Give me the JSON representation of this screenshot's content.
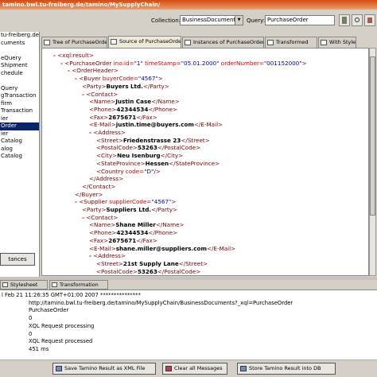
{
  "window": {
    "title": "tamino.bwl.tu-freiberg.de/tamino/MySupplyChain/"
  },
  "toolbar": {
    "collection_label": "Collection:",
    "collection_value": "BusinessDocuments",
    "query_label": "Query:",
    "query_value": "PurchaseOrder"
  },
  "sidebar": {
    "items": [
      "tu-freiberg.de/t",
      "cuments",
      "",
      "eQuery",
      "Shipment",
      "chedule",
      "",
      "Query",
      "gTransaction",
      "firm",
      "Transaction",
      "ier",
      "Order",
      "ier",
      "Catalog",
      "alog",
      "Catalog"
    ],
    "selected_index": 12,
    "instances_button": "tances"
  },
  "tabs": [
    {
      "label": "Tree of PurchaseOrder",
      "active": false
    },
    {
      "label": "Source of PurchaseOrder",
      "active": true
    },
    {
      "label": "Instances of PurchaseOrder",
      "active": false
    },
    {
      "label": "Transformed",
      "active": false
    },
    {
      "label": "With Style",
      "active": false
    }
  ],
  "xml": {
    "lines": [
      {
        "depth": 0,
        "open": "<xql:result>"
      },
      {
        "depth": 1,
        "po": true
      },
      {
        "depth": 2,
        "open": "<OrderHeader>"
      },
      {
        "depth": 3,
        "buyer": true
      },
      {
        "depth": 4,
        "elem": "Party",
        "text": "Buyers Ltd."
      },
      {
        "depth": 4,
        "open": "<Contact>"
      },
      {
        "depth": 5,
        "elem": "Name",
        "text": "Justin Case"
      },
      {
        "depth": 5,
        "elem": "Phone",
        "text": "42344534"
      },
      {
        "depth": 5,
        "elem": "Fax",
        "text": "2675671"
      },
      {
        "depth": 5,
        "elem": "E-Mail",
        "text": "justin.time@buyers.com"
      },
      {
        "depth": 5,
        "open": "<Address>"
      },
      {
        "depth": 6,
        "elem": "Street",
        "text": "Friedenstrasse 23"
      },
      {
        "depth": 6,
        "elem": "PostalCode",
        "text": "53263"
      },
      {
        "depth": 6,
        "elem": "City",
        "text": "Neu Isenburg"
      },
      {
        "depth": 6,
        "elem": "StateProvince",
        "text": "Hessen"
      },
      {
        "depth": 6,
        "elem": "Country code",
        "text": "D"
      },
      {
        "depth": 5,
        "close": "</Address>"
      },
      {
        "depth": 4,
        "close": "</Contact>"
      },
      {
        "depth": 3,
        "close": "</Buyer>"
      },
      {
        "depth": 3,
        "supplier": true
      },
      {
        "depth": 4,
        "elem": "Party",
        "text": "Suppliers Ltd."
      },
      {
        "depth": 4,
        "open": "<Contact>"
      },
      {
        "depth": 5,
        "elem": "Name",
        "text": "Shane Miller"
      },
      {
        "depth": 5,
        "elem": "Phone",
        "text": "42344534"
      },
      {
        "depth": 5,
        "elem": "Fax",
        "text": "2675671"
      },
      {
        "depth": 5,
        "elem": "E-Mail",
        "text": "shane.miller@suppliers.com"
      },
      {
        "depth": 5,
        "open": "<Address>"
      },
      {
        "depth": 6,
        "elem": "Street",
        "text": "21st Supply Lane"
      },
      {
        "depth": 6,
        "elem": "PostalCode",
        "text": "53263"
      }
    ],
    "po": {
      "tag": "PurchaseOrder",
      "a1n": "ino:id",
      "a1v": "1",
      "a2n": "timeStamp",
      "a2v": "05.01.2000",
      "a3n": "orderNumber",
      "a3v": "001152000"
    },
    "buyer": {
      "tag": "Buyer",
      "an": "buyerCode",
      "av": "4567"
    },
    "supplier": {
      "tag": "Supplier",
      "an": "supplierCode",
      "av": "4567"
    }
  },
  "bottom_tabs": [
    "Stylesheet",
    "Transformation"
  ],
  "log": [
    "l Feb 21 11:26:35 GMT+01:00 2007 ***************",
    "http://tamino.bwl.tu-freiberg.de/tamino/MySupplyChain/BusinessDocuments?_xql=PurchaseOrder",
    "PurchaseOrder",
    "0",
    "XQL Request processing",
    "0",
    "XQL Request processed",
    "451 ms"
  ],
  "buttons": {
    "save": "Save Tamino Result as XML File",
    "clear": "Clear all Messages",
    "store": "Store Tamino Result into DB"
  }
}
